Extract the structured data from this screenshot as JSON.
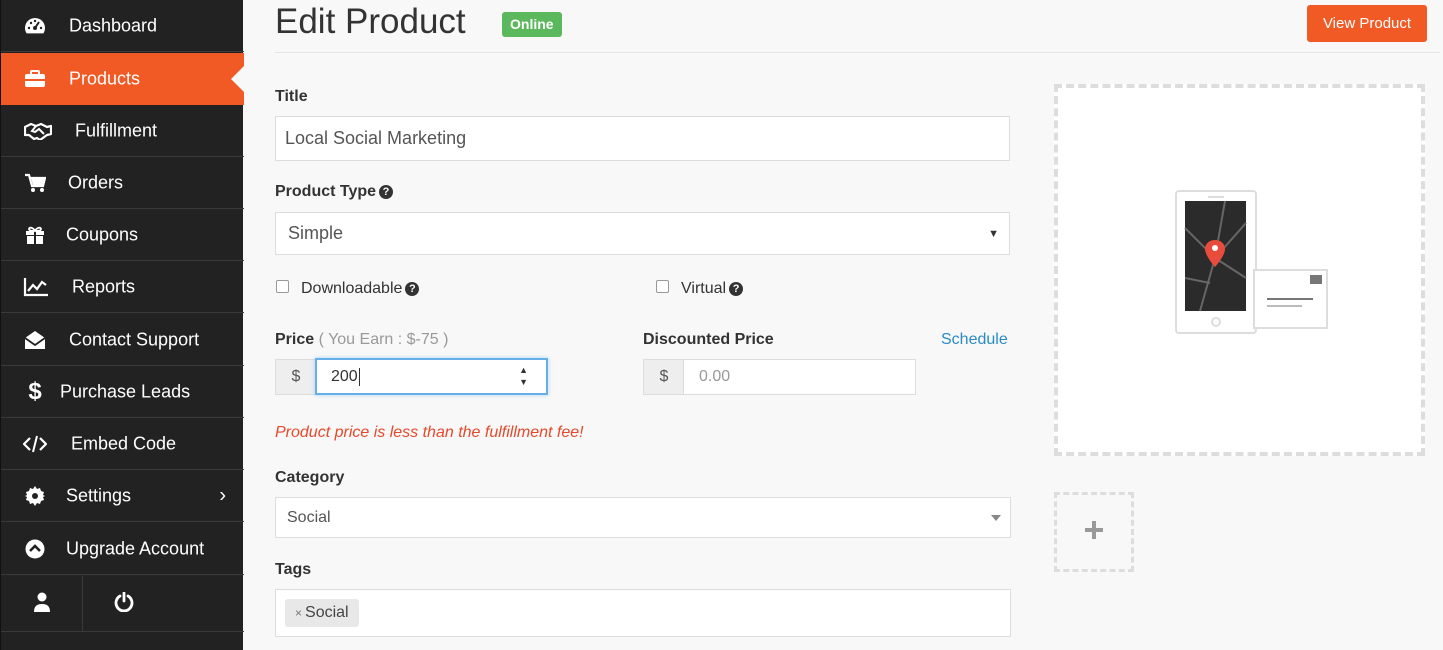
{
  "sidebar": {
    "items": [
      {
        "label": "Dashboard",
        "icon": "dashboard-icon"
      },
      {
        "label": "Products",
        "icon": "briefcase-icon",
        "active": true
      },
      {
        "label": "Fulfillment",
        "icon": "handshake-icon"
      },
      {
        "label": "Orders",
        "icon": "cart-icon"
      },
      {
        "label": "Coupons",
        "icon": "gift-icon"
      },
      {
        "label": "Reports",
        "icon": "line-chart-icon"
      },
      {
        "label": "Contact Support",
        "icon": "envelope-open-icon"
      },
      {
        "label": "Purchase Leads",
        "icon": "dollar-icon"
      },
      {
        "label": "Embed Code",
        "icon": "code-icon"
      },
      {
        "label": "Settings",
        "icon": "gear-icon",
        "has_submenu": true
      },
      {
        "label": "Upgrade Account",
        "icon": "chevron-up-circle-icon"
      }
    ],
    "bottom": [
      {
        "icon": "user-icon"
      },
      {
        "icon": "power-icon"
      }
    ]
  },
  "header": {
    "title": "Edit Product",
    "status_badge": "Online",
    "view_button": "View Product"
  },
  "form": {
    "title_label": "Title",
    "title_value": "Local Social Marketing",
    "product_type_label": "Product Type",
    "product_type_value": "Simple",
    "downloadable_label": "Downloadable",
    "virtual_label": "Virtual",
    "price_label": "Price",
    "price_earn_note": "( You Earn : $-75 )",
    "currency_symbol": "$",
    "price_value": "200",
    "discounted_label": "Discounted Price",
    "discounted_placeholder": "0.00",
    "schedule_link": "Schedule",
    "error_message": "Product price is less than the fulfillment fee!",
    "category_label": "Category",
    "category_value": "Social",
    "tags_label": "Tags",
    "tags": [
      "Social"
    ],
    "tag_remove_glyph": "×"
  },
  "colors": {
    "accent": "#f15a24",
    "sidebar_bg": "#222222",
    "online_badge": "#5cb85c",
    "error": "#e5492b",
    "link": "#2a8bc6"
  }
}
